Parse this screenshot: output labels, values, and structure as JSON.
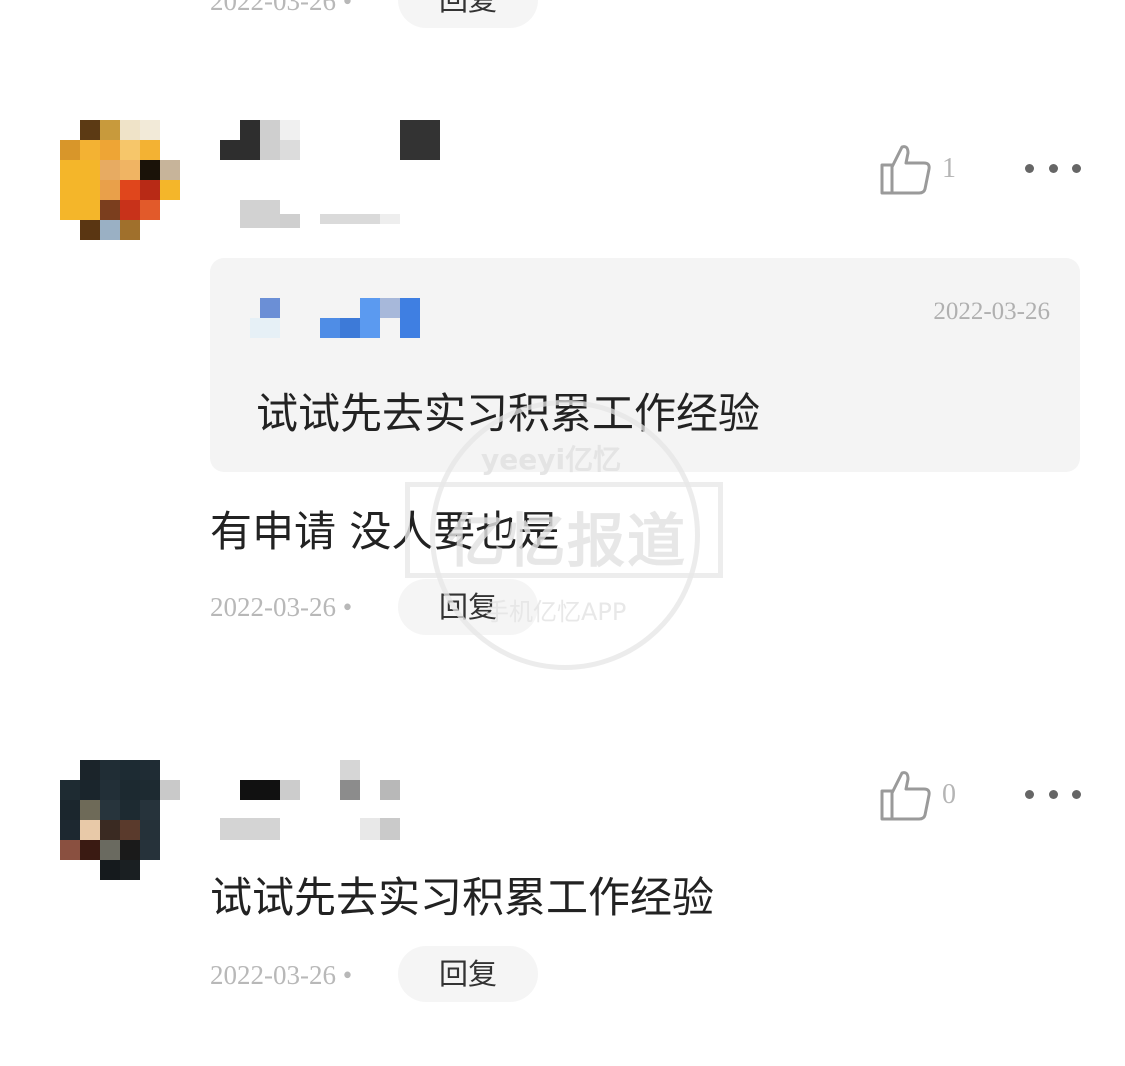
{
  "top_fragment": {
    "date": "2022-03-26 •",
    "reply_label": "回复"
  },
  "comment1": {
    "like_count": "1",
    "quote": {
      "date": "2022-03-26",
      "text": "试试先去实习积累工作经验"
    },
    "text": "有申请 没人要也是",
    "date": "2022-03-26 •",
    "reply_label": "回复"
  },
  "comment2": {
    "like_count": "0",
    "text": "试试先去实习积累工作经验",
    "date": "2022-03-26 •",
    "reply_label": "回复"
  },
  "watermark": {
    "top": "yeeyi亿忆",
    "main": "亿忆报道",
    "bottom": "手机亿忆APP"
  },
  "icons": {
    "like": "thumbs-up-icon",
    "more": "more-dots-icon"
  },
  "colors": {
    "avatar1_primary": "#f5b62a",
    "avatar2_primary": "#1c2a33",
    "quote_name_blue": "#4a8fe0"
  }
}
